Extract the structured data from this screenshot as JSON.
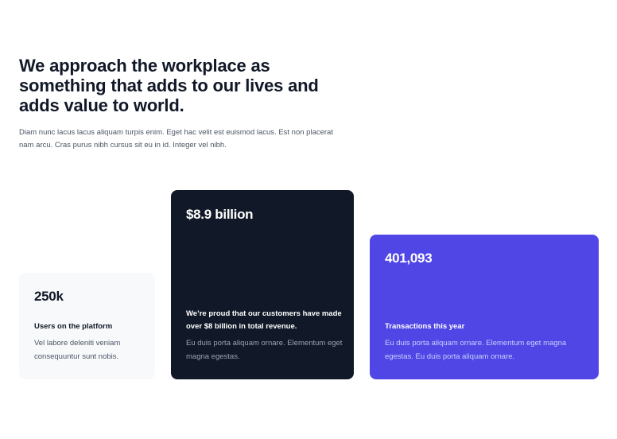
{
  "header": {
    "headline": "We approach the workplace as something that adds to our lives and adds value to world.",
    "intro": "Diam nunc lacus lacus aliquam turpis enim. Eget hac velit est euismod lacus. Est non placerat nam arcu. Cras purus nibh cursus sit eu in id. Integer vel nibh."
  },
  "stats": [
    {
      "value": "250k",
      "title": "Users on the platform",
      "description": "Vel labore deleniti veniam consequuntur sunt nobis."
    },
    {
      "value": "$8.9 billion",
      "title": "We’re proud that our customers have made over $8 billion in total revenue.",
      "description": "Eu duis porta aliquam ornare. Elementum eget magna egestas."
    },
    {
      "value": "401,093",
      "title": "Transactions this year",
      "description": "Eu duis porta aliquam ornare. Elementum eget magna egestas. Eu duis porta aliquam ornare."
    }
  ],
  "colors": {
    "text_primary": "#111827",
    "dark_card": "#111827",
    "accent_card": "#4f46e5",
    "light_card": "#f8f9fb"
  }
}
